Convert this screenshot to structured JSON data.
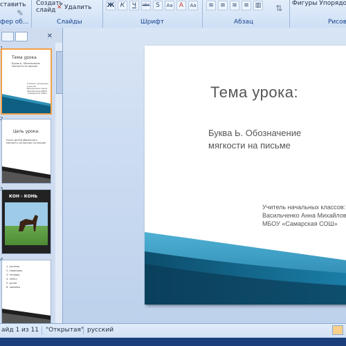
{
  "ribbon": {
    "paste_label": "ставить",
    "clipboard_group": "фер об...",
    "create_slide_label": "Создать слайд",
    "delete_label": "Удалить",
    "slides_group": "Слайды",
    "font_group": "Шрифт",
    "paragraph_group": "Абзац",
    "shapes_label": "Фигуры Упорядочи",
    "drawing_group": "Рисова",
    "format_buttons": [
      "Ж",
      "К",
      "Ч",
      "abc",
      "S",
      "Aa",
      "A",
      "Aa"
    ]
  },
  "thumbnails": [
    {
      "num": "1",
      "title": "Тема урока",
      "sub": "Буква Ь. Обозначение мягкости на письме",
      "auth": "Учитель начальных классов: Васильченко Анна Михайловна МБОУ «Самарская СОШ»"
    },
    {
      "num": "2",
      "title": "Цель урока:",
      "sub": "Учить детей обозначать мягкость согласных на письме"
    },
    {
      "num": "3",
      "caption": "КОН - КОНЬ"
    },
    {
      "num": "4",
      "list": [
        "1. котенок",
        "2. карандаш",
        "3. тетрадь",
        "4. пенал",
        "5. ручка",
        "6. линейка"
      ]
    }
  ],
  "slide": {
    "title": "Тема урока:",
    "subtitle_line1": "Буква Ь. Обозначение",
    "subtitle_line2": "мягкости на письме",
    "author_line1": "Учитель начальных классов:",
    "author_line2": "Васильченко Анна Михайловна",
    "author_line3": "МБОУ «Самарская СОШ»"
  },
  "status": {
    "slide_counter": "айд 1 из 11",
    "theme": "\"Открытая\"",
    "language": "русский"
  },
  "colors": {
    "accent": "#2f8fb5",
    "selection": "#f3a046"
  }
}
